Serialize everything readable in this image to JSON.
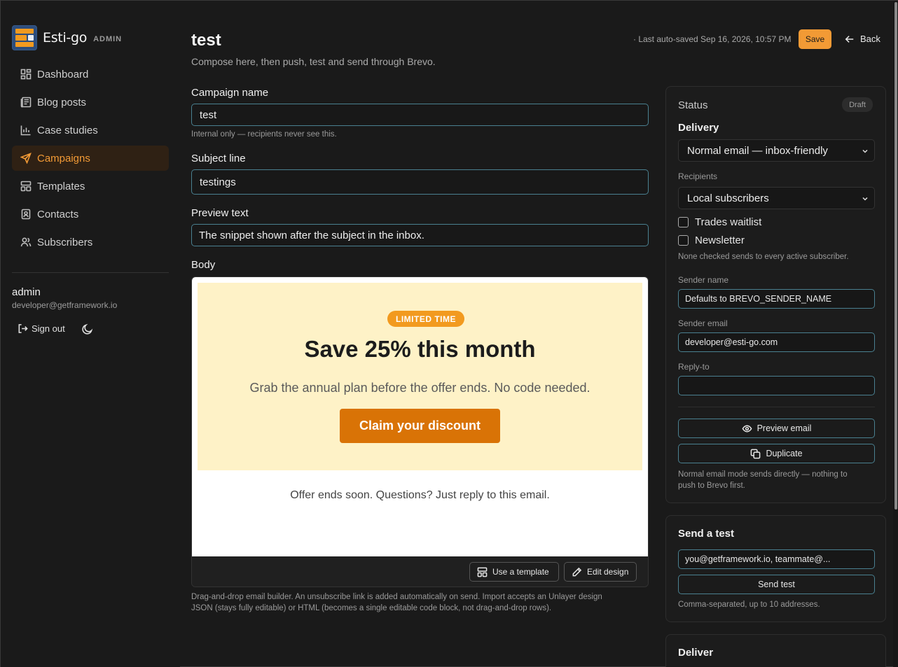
{
  "brand": {
    "name": "Esti-go",
    "tag": "ADMIN"
  },
  "nav": [
    {
      "label": "Dashboard",
      "icon": "dashboard-icon"
    },
    {
      "label": "Blog posts",
      "icon": "newspaper-icon"
    },
    {
      "label": "Case studies",
      "icon": "bar-chart-icon"
    },
    {
      "label": "Campaigns",
      "icon": "send-icon",
      "active": true
    },
    {
      "label": "Templates",
      "icon": "layout-icon"
    },
    {
      "label": "Contacts",
      "icon": "contact-book-icon"
    },
    {
      "label": "Subscribers",
      "icon": "users-icon"
    }
  ],
  "user": {
    "name": "admin",
    "email": "developer@getframework.io",
    "sign_out": "Sign out"
  },
  "header": {
    "title": "test",
    "subtitle": "Compose here, then push, test and send through Brevo.",
    "autosave": "· Last auto-saved Sep 16, 2026, 10:57 PM",
    "save": "Save",
    "back": "Back"
  },
  "form": {
    "campaign_name_label": "Campaign name",
    "campaign_name": "test",
    "campaign_name_hint": "Internal only — recipients never see this.",
    "subject_label": "Subject line",
    "subject": "testings",
    "preview_label": "Preview text",
    "preview_placeholder": "The snippet shown after the subject in the inbox.",
    "body_label": "Body",
    "body_hint_1": "Drag-and-drop email builder. An unsubscribe link is added automatically on send. Import accepts an Unlayer design",
    "body_hint_2": "JSON (stays fully editable) or HTML (becomes a single editable code block, not drag-and-drop rows)."
  },
  "email": {
    "badge": "LIMITED TIME",
    "headline": "Save 25% this month",
    "sub": "Grab the annual plan before the offer ends. No code needed.",
    "cta": "Claim your discount",
    "footer": "Offer ends soon. Questions? Just reply to this email."
  },
  "editor": {
    "use_template": "Use a template",
    "edit_design": "Edit design"
  },
  "status": {
    "title": "Status",
    "badge": "Draft",
    "delivery_label": "Delivery",
    "delivery": "Normal email — inbox-friendly",
    "recipients_label": "Recipients",
    "recipients": "Local subscribers",
    "lists": [
      "Trades waitlist",
      "Newsletter"
    ],
    "lists_hint": "None checked sends to every active subscriber.",
    "sender_name_label": "Sender name",
    "sender_name_placeholder": "Defaults to BREVO_SENDER_NAME",
    "sender_email_label": "Sender email",
    "sender_email": "developer@esti-go.com",
    "reply_to_label": "Reply-to",
    "reply_to": "",
    "preview_btn": "Preview email",
    "duplicate_btn": "Duplicate",
    "mode_hint_1": "Normal email mode sends directly — nothing to",
    "mode_hint_2": "push to Brevo first."
  },
  "test": {
    "title": "Send a test",
    "placeholder": "you@getframework.io, teammate@...",
    "button": "Send test",
    "hint": "Comma-separated, up to 10 addresses."
  },
  "deliver": {
    "title": "Deliver"
  },
  "colors": {
    "accent": "#f29a35",
    "active_bg": "#2f2114",
    "field_border": "#4a8090",
    "promo_bg": "#fef2c7",
    "cta": "#d97306"
  }
}
